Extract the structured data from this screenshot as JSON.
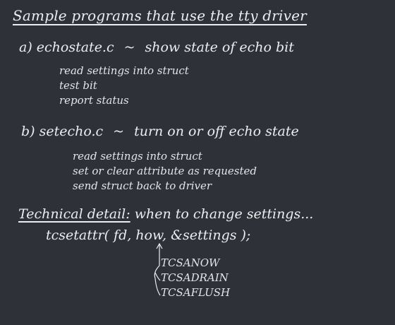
{
  "title": "Sample programs that use the tty driver",
  "sections": [
    {
      "label": "a) echostate.c",
      "separator": "~",
      "desc": "show state of echo bit",
      "steps": [
        "read settings into struct",
        "test bit",
        "report status"
      ]
    },
    {
      "label": "b) setecho.c",
      "separator": "~",
      "desc": "turn on or off echo state",
      "steps": [
        "read settings into struct",
        "set or clear attribute as requested",
        "send struct back to driver"
      ]
    }
  ],
  "technical": {
    "label": "Technical detail:",
    "text": "when to change settings...",
    "code": "tcsetattr( fd,  how, &settings );",
    "options": [
      "TCSANOW",
      "TCSADRAIN",
      "TCSAFLUSH"
    ]
  }
}
